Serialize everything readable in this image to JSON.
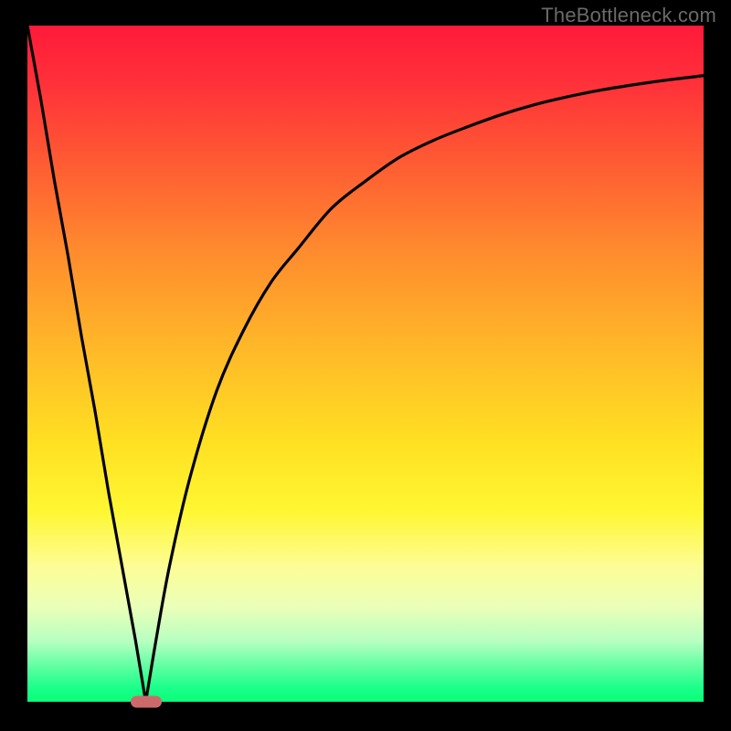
{
  "watermark": "TheBottleneck.com",
  "colors": {
    "curve_stroke": "#000000",
    "pill_fill": "#cc6a6a"
  },
  "chart_data": {
    "type": "line",
    "title": "",
    "xlabel": "",
    "ylabel": "",
    "xlim": [
      0,
      100
    ],
    "ylim": [
      0,
      100
    ],
    "grid": false,
    "legend": false,
    "series": [
      {
        "name": "curve",
        "x": [
          0,
          2,
          4,
          6,
          8,
          10,
          12,
          14,
          16,
          17.5,
          19,
          21,
          24,
          28,
          32,
          36,
          40,
          45,
          50,
          55,
          60,
          65,
          70,
          75,
          80,
          85,
          90,
          95,
          100
        ],
        "y": [
          100,
          89,
          77,
          66,
          54,
          43,
          31,
          20,
          9,
          0,
          9,
          20,
          33,
          46,
          55,
          62,
          67,
          73,
          77,
          80.5,
          83,
          85,
          86.8,
          88.3,
          89.5,
          90.5,
          91.3,
          92,
          92.6
        ]
      }
    ],
    "marker": {
      "x": 17.5,
      "y": 0,
      "shape": "pill"
    }
  }
}
